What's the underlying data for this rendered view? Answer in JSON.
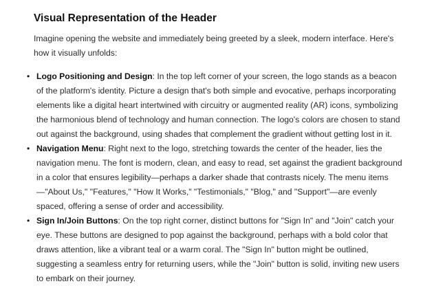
{
  "section": {
    "heading": "Visual Representation of the Header",
    "intro": "Imagine opening the website and immediately being greeted by a sleek, modern interface. Here's how it visually unfolds:"
  },
  "bullets": [
    {
      "title": "Logo Positioning and Design",
      "text": ": In the top left corner of your screen, the logo stands as a beacon of the platform's identity. Picture a design that's both simple and evocative, perhaps incorporating elements like a digital heart intertwined with circuitry or augmented reality (AR) icons, symbolizing the harmonious blend of technology and human connection. The logo's colors are chosen to stand out against the background, using shades that complement the gradient without getting lost in it."
    },
    {
      "title": "Navigation Menu",
      "text": ": Right next to the logo, stretching towards the center of the header, lies the navigation menu. The font is modern, clean, and easy to read, set against the gradient background in a color that ensures legibility—perhaps a darker shade that contrasts nicely. The menu items—\"About Us,\" \"Features,\" \"How It Works,\" \"Testimonials,\" \"Blog,\" and \"Support\"—are evenly spaced, offering a sense of order and accessibility."
    },
    {
      "title": "Sign In/Join Buttons",
      "text": ": On the top right corner, distinct buttons for \"Sign In\" and \"Join\" catch your eye. These buttons are designed to pop against the background, perhaps with a bold color that draws attention, like a vibrant teal or a warm coral. The \"Sign In\" button might be outlined, suggesting a seamless entry for returning users, while the \"Join\" button is solid, inviting new users to embark on their journey."
    }
  ],
  "bullet_glyph": "•"
}
